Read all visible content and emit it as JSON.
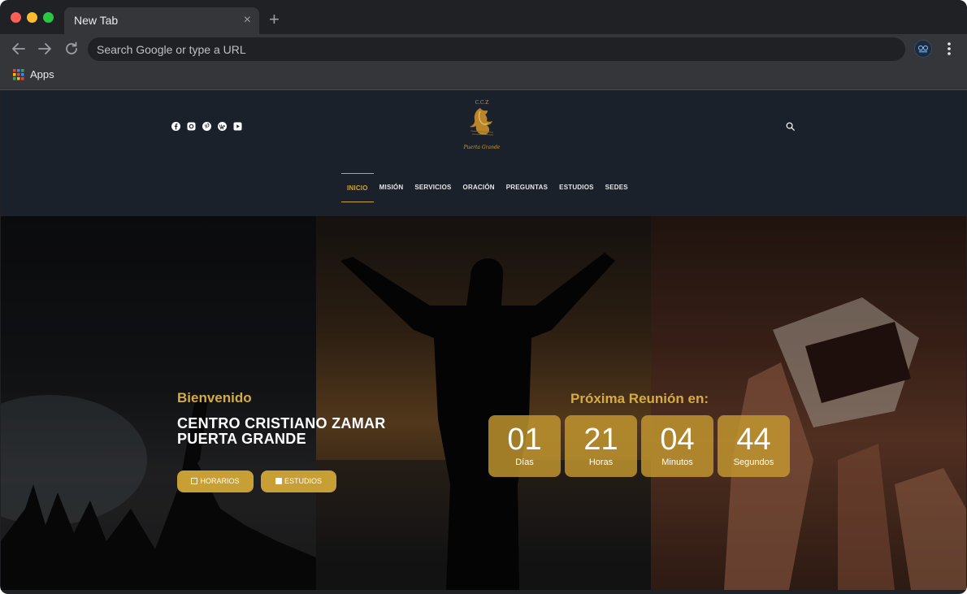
{
  "browser": {
    "tab_title": "New Tab",
    "tab_close": "×",
    "new_tab": "+",
    "omnibox_placeholder": "Search Google or type a URL",
    "bookmarks": [
      {
        "label": "Apps"
      }
    ]
  },
  "site": {
    "social_icons": [
      "facebook-icon",
      "instagram-icon",
      "pinterest-icon",
      "wordpress-icon",
      "youtube-icon"
    ],
    "logo_text_top": "C.C.Z",
    "logo_text_bottom": "Puerta Grande",
    "menu": [
      {
        "label": "INICIO",
        "active": true
      },
      {
        "label": "MISIÓN"
      },
      {
        "label": "SERVICIOS"
      },
      {
        "label": "ORACIÓN"
      },
      {
        "label": "PREGUNTAS"
      },
      {
        "label": "ESTUDIOS"
      },
      {
        "label": "SEDES"
      }
    ]
  },
  "hero": {
    "welcome": "Bienvenido",
    "title_line1": "CENTRO CRISTIANO ZAMAR",
    "title_line2": "PUERTA GRANDE",
    "buttons": [
      {
        "label": "HORARIOS"
      },
      {
        "label": "ESTUDIOS"
      }
    ],
    "countdown_title": "Próxima Reunión en:",
    "countdown": [
      {
        "value": "01",
        "label": "Días"
      },
      {
        "value": "21",
        "label": "Horas"
      },
      {
        "value": "04",
        "label": "Minutos"
      },
      {
        "value": "44",
        "label": "Segundos"
      }
    ]
  },
  "colors": {
    "accent_gold": "#cda43c",
    "header_bg": "#1a212a",
    "browser_chrome": "#35363a"
  }
}
